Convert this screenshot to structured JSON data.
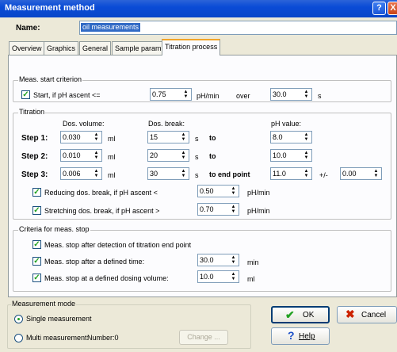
{
  "window": {
    "title": "Measurement method",
    "help_glyph": "?",
    "close_glyph": "X"
  },
  "name": {
    "label": "Name:",
    "value": "oil measurements"
  },
  "tabs": [
    "Overview",
    "Graphics",
    "General",
    "Sample param.",
    "Titration process"
  ],
  "start": {
    "legend": "Meas. start criterion",
    "checkbox_label": "Start, if pH ascent <=",
    "value": "0.75",
    "unit": "pH/min",
    "over": "over",
    "time": "30.0",
    "time_unit": "s"
  },
  "titration": {
    "legend": "Titration",
    "col_volume": "Dos. volume:",
    "col_break": "Dos. break:",
    "col_ph": "pH value:",
    "steps": [
      {
        "label": "Step 1:",
        "volume": "0.030",
        "vol_unit": "ml",
        "break": "15",
        "break_unit": "s",
        "to": "to",
        "ph": "8.0"
      },
      {
        "label": "Step 2:",
        "volume": "0.010",
        "vol_unit": "ml",
        "break": "20",
        "break_unit": "s",
        "to": "to",
        "ph": "10.0"
      },
      {
        "label": "Step 3:",
        "volume": "0.006",
        "vol_unit": "ml",
        "break": "30",
        "break_unit": "s",
        "to": "to end point",
        "ph": "11.0"
      }
    ],
    "tolerance_sign": "+/-",
    "tolerance": "0.00",
    "reducing": {
      "label": "Reducing dos. break, if pH ascent <",
      "value": "0.50",
      "unit": "pH/min"
    },
    "stretching": {
      "label": "Stretching dos. break, if pH ascent >",
      "value": "0.70",
      "unit": "pH/min"
    }
  },
  "stop": {
    "legend": "Criteria for meas. stop",
    "endpoint_label": "Meas. stop after detection of titration end point",
    "time_label": "Meas. stop after a defined time:",
    "time_value": "30.0",
    "time_unit": "min",
    "volume_label": "Meas. stop at a defined dosing volume:",
    "volume_value": "10.0",
    "volume_unit": "ml"
  },
  "mode": {
    "legend": "Measurement mode",
    "single": "Single measurement",
    "multi": "Multi measurement:",
    "number": "Number:0",
    "change": "Change ..."
  },
  "buttons": {
    "ok": "OK",
    "cancel": "Cancel",
    "help": "Help"
  },
  "check_glyph": "✓",
  "colors": {
    "titlebar": "#0a4bd6",
    "selection": "#316ac5",
    "ok_check": "#21a121",
    "cancel_x": "#cc2200",
    "help_q": "#1c50c8"
  }
}
